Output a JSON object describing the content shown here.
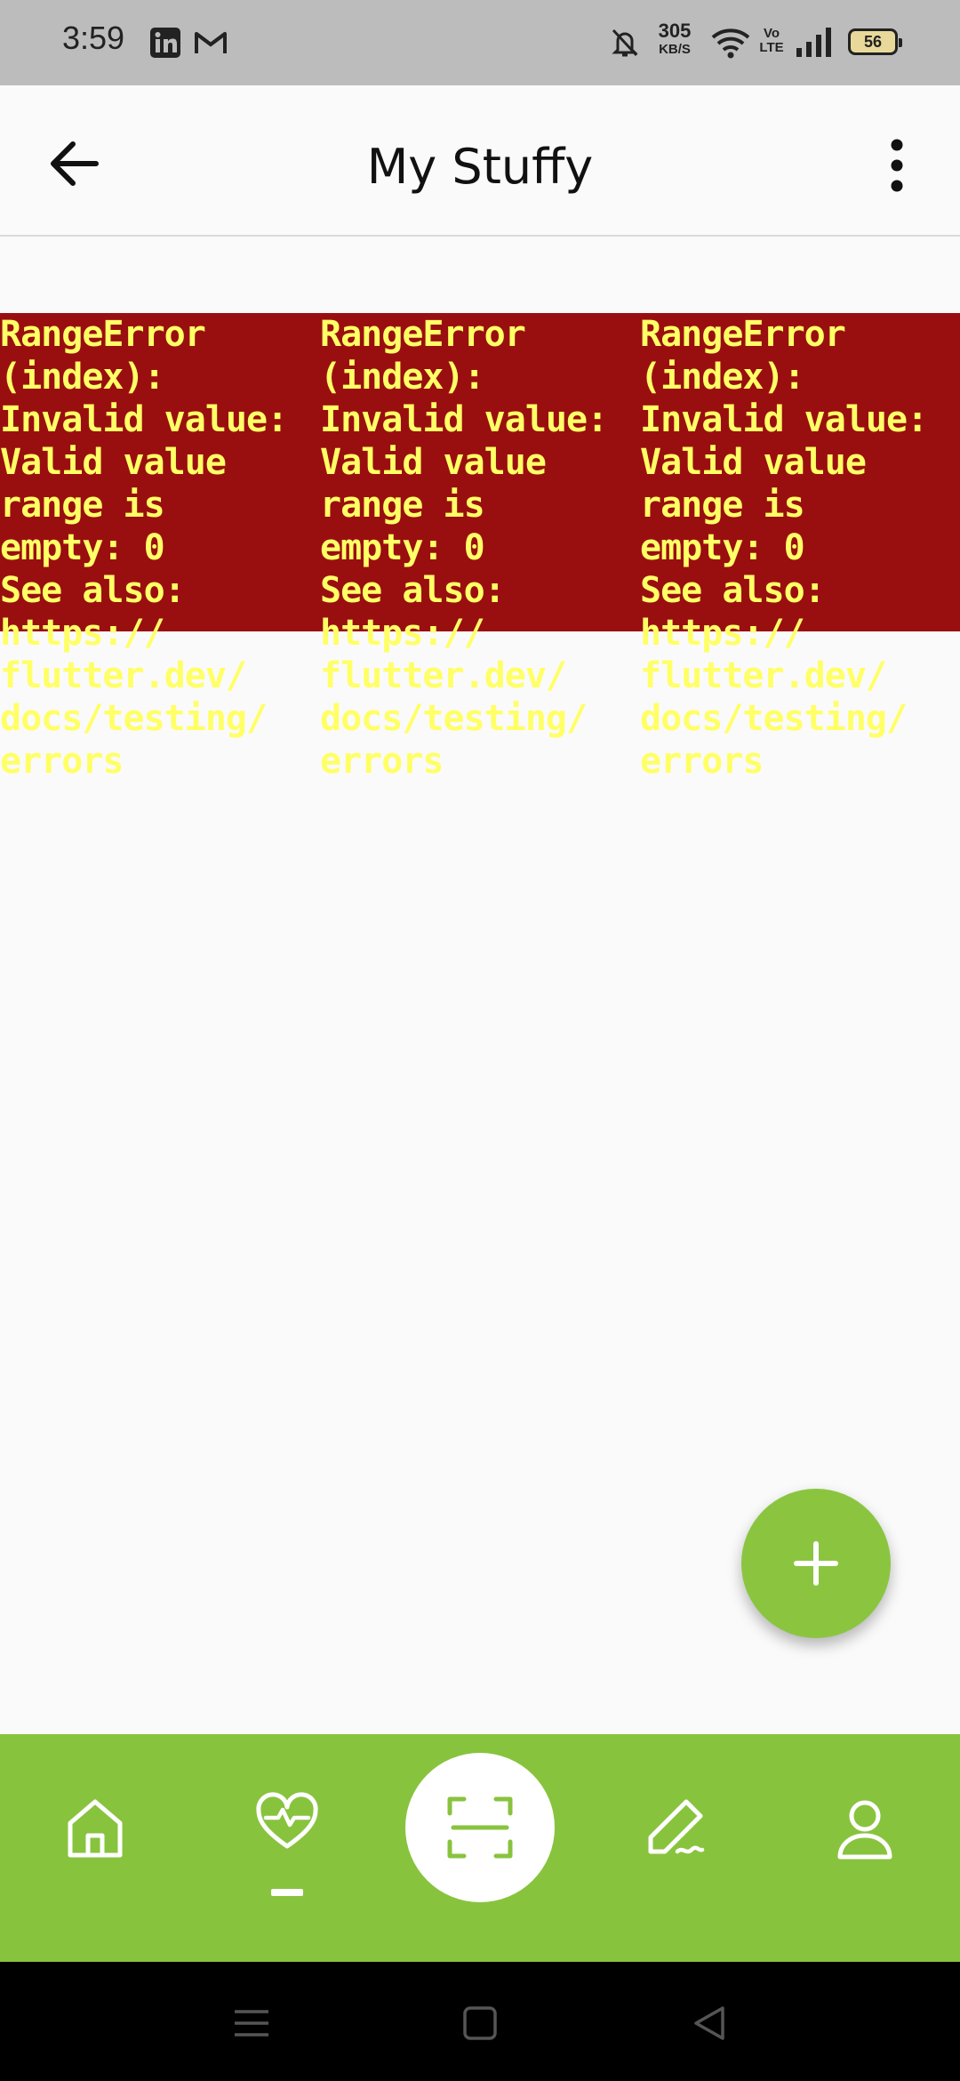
{
  "status_bar": {
    "time": "3:59",
    "net_speed_value": "305",
    "net_speed_unit": "KB/S",
    "volte_label": "Vo LTE",
    "battery_level": "56",
    "app_icons": [
      "linkedin-icon",
      "gmail-icon"
    ],
    "system_icons": [
      "mute-bell-icon",
      "wifi-icon",
      "volte-icon",
      "signal-icon",
      "battery-icon"
    ]
  },
  "app_bar": {
    "title": "My Stuffy",
    "back_icon": "arrow-left-icon",
    "menu_icon": "more-vertical-icon"
  },
  "errors": [
    {
      "message": "RangeError\n(index):\nInvalid value:\nValid value\nrange is\nempty: 0\nSee also:\nhttps://\nflutter.dev/\ndocs/testing/\nerrors"
    },
    {
      "message": "RangeError\n(index):\nInvalid value:\nValid value\nrange is\nempty: 0\nSee also:\nhttps://\nflutter.dev/\ndocs/testing/\nerrors"
    },
    {
      "message": "RangeError\n(index):\nInvalid value:\nValid value\nrange is\nempty: 0\nSee also:\nhttps://\nflutter.dev/\ndocs/testing/\nerrors"
    }
  ],
  "fab": {
    "icon": "plus-icon"
  },
  "bottom_nav": {
    "items": [
      {
        "icon": "home-icon",
        "active": false
      },
      {
        "icon": "heart-pulse-icon",
        "active": true
      },
      {
        "icon": "scan-icon",
        "active": false
      },
      {
        "icon": "pen-icon",
        "active": false
      },
      {
        "icon": "user-icon",
        "active": false
      }
    ]
  },
  "system_nav": {
    "icons": [
      "menu-icon",
      "home-square-icon",
      "back-triangle-icon"
    ]
  },
  "colors": {
    "accent_green": "#88c33e",
    "error_bg": "#990f10",
    "error_text": "#ffff66",
    "status_bar_bg": "#bcbcbc"
  }
}
